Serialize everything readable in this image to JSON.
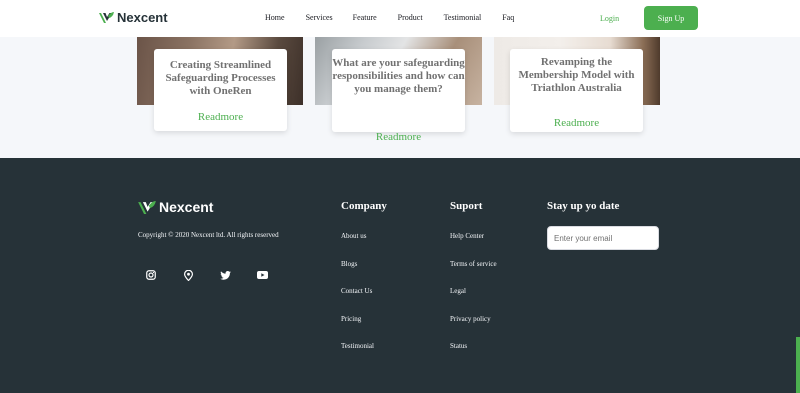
{
  "header": {
    "brand": "Nexcent",
    "nav": [
      "Home",
      "Services",
      "Feature",
      "Product",
      "Testimonial",
      "Faq"
    ],
    "login": "Login",
    "signup": "Sign Up"
  },
  "blog": {
    "cards": [
      {
        "title": "Creating Streamlined Safeguarding Processes with OneRen",
        "link": "Readmore"
      },
      {
        "title": "What are your safeguarding responsibilities and how can you manage them?",
        "link": "Readmore"
      },
      {
        "title": "Revamping the Membership Model with Triathlon Australia",
        "link": "Readmore"
      }
    ]
  },
  "footer": {
    "brand": "Nexcent",
    "copyright": "Copyright © 2020 Nexcent ltd. All rights reserved",
    "socials": [
      "instagram-icon",
      "location-icon",
      "twitter-icon",
      "youtube-icon"
    ],
    "company": {
      "heading": "Company",
      "links": [
        "About us",
        "Blogs",
        "Contact Us",
        "Pricing",
        "Testimonial"
      ]
    },
    "support": {
      "heading": "Suport",
      "links": [
        "Help Center",
        "Terms of service",
        "Legal",
        "Privacy policy",
        "Status"
      ]
    },
    "newsletter": {
      "heading": "Stay up yo date",
      "placeholder": "Enter your email"
    }
  },
  "colors": {
    "accent": "#4caf4f",
    "footer_bg": "#263238",
    "page_bg": "#f5f7fa"
  }
}
